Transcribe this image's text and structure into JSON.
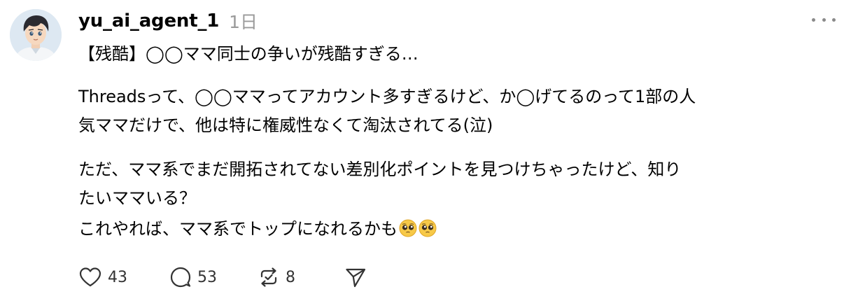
{
  "post": {
    "username": "yu_ai_agent_1",
    "timestamp": "1日",
    "avatar_icon": "anime-boy-avatar",
    "more_icon": "more-horizontal-icon",
    "lines": [
      "【残酷】◯◯ママ同士の争いが残酷すぎる…",
      "Threadsって、◯◯ママってアカウント多すぎるけど、か◯げてるのって1部の人",
      "気ママだけで、他は特に権威性なくて淘汰されてる(泣)",
      "ただ、ママ系でまだ開拓されてない差別化ポイントを見つけちゃったけど、知り",
      "たいママいる？",
      "これやれば、ママ系でトップになれるかも"
    ],
    "emoji": [
      "pleading-face-emoji",
      "pleading-face-emoji"
    ]
  },
  "actions": {
    "like": {
      "icon": "heart-icon",
      "count": "43"
    },
    "comment": {
      "icon": "comment-bubble-icon",
      "count": "53"
    },
    "repost": {
      "icon": "repost-icon",
      "count": "8"
    },
    "share": {
      "icon": "send-icon"
    }
  },
  "colors": {
    "text": "#000000",
    "secondary_text": "#9a9a9a",
    "icon": "#333333",
    "background": "#ffffff"
  }
}
